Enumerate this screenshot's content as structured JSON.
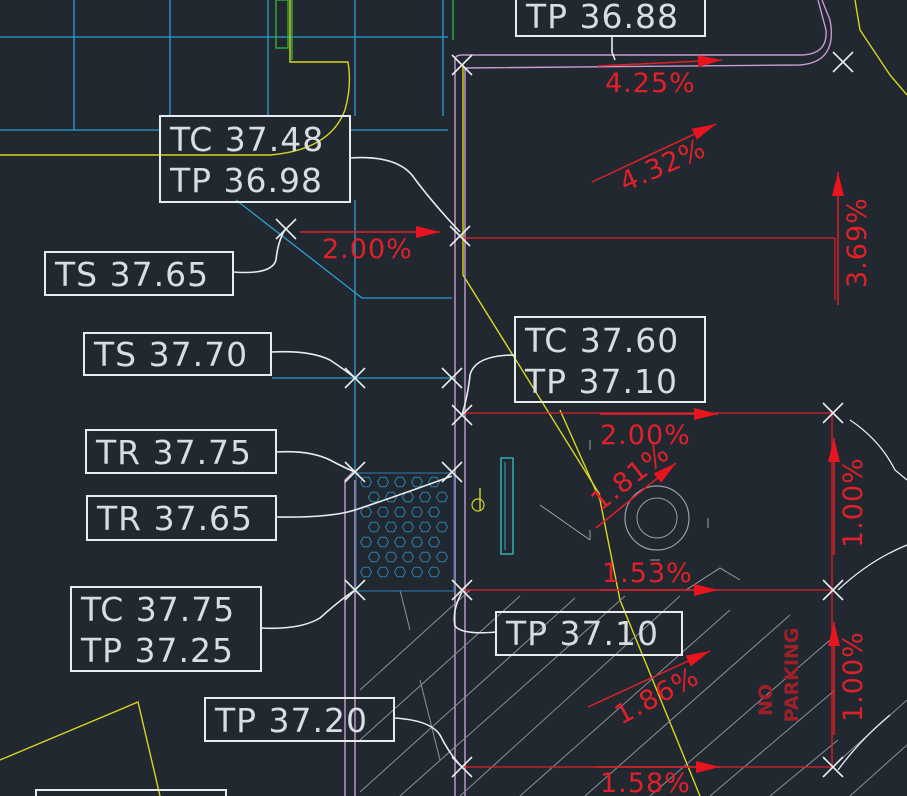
{
  "colors": {
    "background": "#212830",
    "label_text": "#d8dde2",
    "slope_text": "#e0202a",
    "cyan": "#2b9fcf",
    "yellow": "#d8d620",
    "magenta": "#c89ad0",
    "green": "#2fae3a",
    "hatch": "#8a9096"
  },
  "elevation_labels": [
    {
      "line1": "TP 36.88"
    },
    {
      "line1": "TC 37.48",
      "line2": "TP 36.98"
    },
    {
      "line1": "TS 37.65"
    },
    {
      "line1": "TS 37.70"
    },
    {
      "line1": "TC 37.60",
      "line2": "TP 37.10"
    },
    {
      "line1": "TR 37.75"
    },
    {
      "line1": "TR 37.65"
    },
    {
      "line1": "TC 37.75",
      "line2": "TP 37.25"
    },
    {
      "line1": "TP 37.10"
    },
    {
      "line1": "TP 37.20"
    }
  ],
  "slope_labels": [
    "4.25%",
    "4.32%",
    "2.00%",
    "3.69%",
    "2.00%",
    "1.81%",
    "1.53%",
    "1.00%",
    "1.86%",
    "1.00%",
    "1.58%"
  ],
  "no_parking_text": [
    "NO",
    "PARKING"
  ],
  "icons": {
    "grade_arrow": "arrowhead-icon",
    "spot_marker": "x-marker-icon"
  }
}
